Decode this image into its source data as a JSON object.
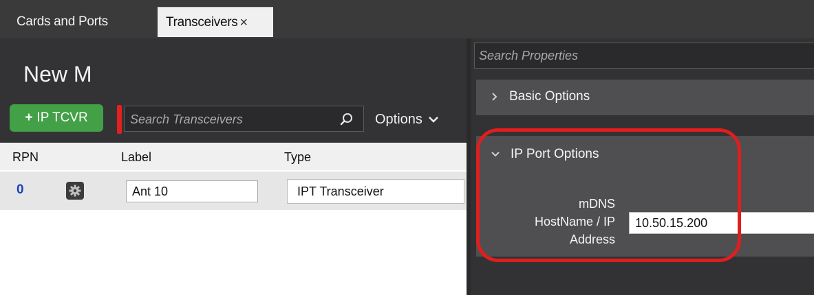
{
  "tabs": [
    {
      "label": "Cards and Ports",
      "active": false
    },
    {
      "label": "Transceivers",
      "active": true,
      "close_icon": "close-icon"
    }
  ],
  "page": {
    "title": "New M"
  },
  "toolbar": {
    "add_button_label": "IP TCVR",
    "add_button_icon": "+",
    "search_placeholder": "Search Transceivers",
    "options_label": "Options",
    "accent_green": "#43a047"
  },
  "table": {
    "columns": [
      "RPN",
      "Label",
      "Type"
    ],
    "rows": [
      {
        "rpn": "0",
        "label": "Ant 10",
        "type": "IPT Transceiver"
      }
    ]
  },
  "properties": {
    "search_placeholder": "Search Properties",
    "sections": [
      {
        "title": "Basic Options",
        "expanded": false
      },
      {
        "title": "IP Port Options",
        "expanded": true,
        "fields": [
          {
            "label_lines": [
              "mDNS",
              "HostName / IP",
              "Address"
            ],
            "value": "10.50.15.200"
          }
        ]
      }
    ],
    "highlight_color": "#e11d1d"
  }
}
